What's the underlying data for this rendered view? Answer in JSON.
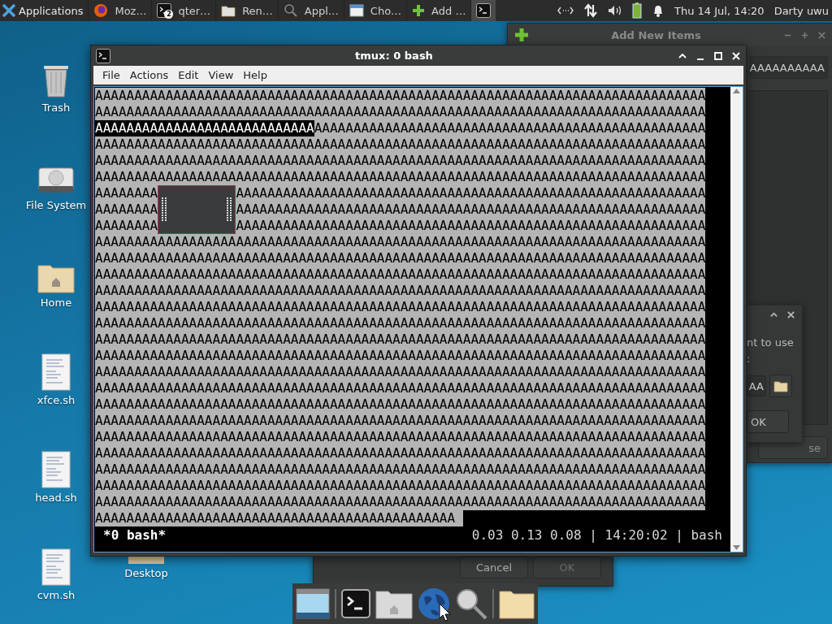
{
  "top_panel": {
    "app_menu": {
      "label": "Applications"
    },
    "tasks": [
      {
        "kind": "browser",
        "label": "Moz…",
        "selected": false
      },
      {
        "kind": "terminal",
        "label": "qter…",
        "badge": "2",
        "selected": false
      },
      {
        "kind": "folder",
        "label": "Ren…",
        "selected": false
      },
      {
        "kind": "search",
        "label": "Appl…",
        "selected": false
      },
      {
        "kind": "window",
        "label": "Cho…",
        "selected": false
      },
      {
        "kind": "plus",
        "label": "Add …",
        "selected": false
      },
      {
        "kind": "terminal",
        "selected": true
      }
    ],
    "tray": {
      "datetime": "Thu 14 Jul, 14:20",
      "user": "Darty uwu"
    }
  },
  "desktop_icons": [
    {
      "kind": "trash",
      "label": "Trash"
    },
    {
      "kind": "drive",
      "label": "File System"
    },
    {
      "kind": "home",
      "label": "Home"
    },
    {
      "kind": "script",
      "label": "xfce.sh"
    },
    {
      "kind": "script",
      "label": "head.sh"
    },
    {
      "kind": "script",
      "label": "cvm.sh"
    }
  ],
  "desktop_folder": {
    "label": "Desktop"
  },
  "add_items_window": {
    "title": "Add New Items",
    "field_value": "AAAAAAAAAA",
    "button": "se"
  },
  "small_dialog": {
    "text_lines": [
      "nt to use",
      ":"
    ],
    "field_value": "AA",
    "ok_button": "OK"
  },
  "bottom_dialog": {
    "buttons": [
      {
        "label": "Cancel",
        "disabled": false
      },
      {
        "label": "OK",
        "disabled": true
      }
    ]
  },
  "terminal": {
    "title": "tmux: 0 bash",
    "menu": [
      "File",
      "Actions",
      "Edit",
      "View",
      "Help"
    ],
    "lines": [
      {
        "segments": [
          {
            "text": "AAAAAAAAAAAAAAAAAAAAAAAAAAAAAAAAAAAAAAAAAAAAAAAAAAAAAAAAAAAAAAAAAAAAAAAAAAAAAA",
            "selected": false
          }
        ]
      },
      {
        "segments": [
          {
            "text": "AAAAAAAAAAAAAAAAAAAAAAAAAAAAAAAAAAAAAAAAAAAAAAAAAAAAAAAAAAAAAAAAAAAAAAAAAAAAAA",
            "selected": false
          }
        ]
      },
      {
        "segments": [
          {
            "text": "AAAAAAAAAAAAAAAAAAAAAAAAAAAA",
            "selected": true
          },
          {
            "text": "AAAAAAAAAAAAAAAAAAAAAAAAAAAAAAAAAAAAAAAAAAAAAAAAAA",
            "selected": false
          }
        ]
      },
      {
        "segments": [
          {
            "text": "AAAAAAAAAAAAAAAAAAAAAAAAAAAAAAAAAAAAAAAAAAAAAAAAAAAAAAAAAAAAAAAAAAAAAAAAAAAAAA",
            "selected": false
          }
        ]
      },
      {
        "segments": [
          {
            "text": "AAAAAAAAAAAAAAAAAAAAAAAAAAAAAAAAAAAAAAAAAAAAAAAAAAAAAAAAAAAAAAAAAAAAAAAAAAAAAA",
            "selected": false
          }
        ]
      },
      {
        "segments": [
          {
            "text": "AAAAAAAAAAAAAAAAAAAAAAAAAAAAAAAAAAAAAAAAAAAAAAAAAAAAAAAAAAAAAAAAAAAAAAAAAAAAAA",
            "selected": false
          }
        ]
      },
      {
        "covered": true,
        "segments": [
          {
            "text": "AAAAAAAA",
            "selected": false
          },
          {
            "text": "AAAAAAAAAAAAAAAAAAAAAAAAAAAAAAAAAAAAAAAAAAAAAAAAAAAAAAAAAAAA",
            "selected": false
          }
        ]
      },
      {
        "covered": true,
        "segments": [
          {
            "text": "AAAAAAAA",
            "selected": false
          },
          {
            "text": "AAAAAAAAAAAAAAAAAAAAAAAAAAAAAAAAAAAAAAAAAAAAAAAAAAAAAAAAAAAA",
            "selected": false
          }
        ]
      },
      {
        "covered": true,
        "segments": [
          {
            "text": "AAAAAAAA",
            "selected": false
          },
          {
            "text": "AAAAAAAAAAAAAAAAAAAAAAAAAAAAAAAAAAAAAAAAAAAAAAAAAAAAAAAAAAAA",
            "selected": false
          }
        ]
      },
      {
        "segments": [
          {
            "text": "AAAAAAAAAAAAAAAAAAAAAAAAAAAAAAAAAAAAAAAAAAAAAAAAAAAAAAAAAAAAAAAAAAAAAAAAAAAAAA",
            "selected": false
          }
        ]
      },
      {
        "segments": [
          {
            "text": "AAAAAAAAAAAAAAAAAAAAAAAAAAAAAAAAAAAAAAAAAAAAAAAAAAAAAAAAAAAAAAAAAAAAAAAAAAAAAA",
            "selected": false
          }
        ]
      },
      {
        "segments": [
          {
            "text": "AAAAAAAAAAAAAAAAAAAAAAAAAAAAAAAAAAAAAAAAAAAAAAAAAAAAAAAAAAAAAAAAAAAAAAAAAAAAAA",
            "selected": false
          }
        ]
      },
      {
        "segments": [
          {
            "text": "AAAAAAAAAAAAAAAAAAAAAAAAAAAAAAAAAAAAAAAAAAAAAAAAAAAAAAAAAAAAAAAAAAAAAAAAAAAAAA",
            "selected": false
          }
        ]
      },
      {
        "segments": [
          {
            "text": "AAAAAAAAAAAAAAAAAAAAAAAAAAAAAAAAAAAAAAAAAAAAAAAAAAAAAAAAAAAAAAAAAAAAAAAAAAAAAA",
            "selected": false
          }
        ]
      },
      {
        "segments": [
          {
            "text": "AAAAAAAAAAAAAAAAAAAAAAAAAAAAAAAAAAAAAAAAAAAAAAAAAAAAAAAAAAAAAAAAAAAAAAAAAAAAAA",
            "selected": false
          }
        ]
      },
      {
        "segments": [
          {
            "text": "AAAAAAAAAAAAAAAAAAAAAAAAAAAAAAAAAAAAAAAAAAAAAAAAAAAAAAAAAAAAAAAAAAAAAAAAAAAAAA",
            "selected": false
          }
        ]
      },
      {
        "segments": [
          {
            "text": "AAAAAAAAAAAAAAAAAAAAAAAAAAAAAAAAAAAAAAAAAAAAAAAAAAAAAAAAAAAAAAAAAAAAAAAAAAAAAA",
            "selected": false
          }
        ]
      },
      {
        "segments": [
          {
            "text": "AAAAAAAAAAAAAAAAAAAAAAAAAAAAAAAAAAAAAAAAAAAAAAAAAAAAAAAAAAAAAAAAAAAAAAAAAAAAAA",
            "selected": false
          }
        ]
      },
      {
        "segments": [
          {
            "text": "AAAAAAAAAAAAAAAAAAAAAAAAAAAAAAAAAAAAAAAAAAAAAAAAAAAAAAAAAAAAAAAAAAAAAAAAAAAAAA",
            "selected": false
          }
        ]
      },
      {
        "segments": [
          {
            "text": "AAAAAAAAAAAAAAAAAAAAAAAAAAAAAAAAAAAAAAAAAAAAAAAAAAAAAAAAAAAAAAAAAAAAAAAAAAAAAA",
            "selected": false
          }
        ]
      },
      {
        "segments": [
          {
            "text": "AAAAAAAAAAAAAAAAAAAAAAAAAAAAAAAAAAAAAAAAAAAAAAAAAAAAAAAAAAAAAAAAAAAAAAAAAAAAAA",
            "selected": false
          }
        ]
      },
      {
        "segments": [
          {
            "text": "AAAAAAAAAAAAAAAAAAAAAAAAAAAAAAAAAAAAAAAAAAAAAAAAAAAAAAAAAAAAAAAAAAAAAAAAAAAAAA",
            "selected": false
          }
        ]
      },
      {
        "segments": [
          {
            "text": "AAAAAAAAAAAAAAAAAAAAAAAAAAAAAAAAAAAAAAAAAAAAAAAAAAAAAAAAAAAAAAAAAAAAAAAAAAAAAA",
            "selected": false
          }
        ]
      },
      {
        "segments": [
          {
            "text": "AAAAAAAAAAAAAAAAAAAAAAAAAAAAAAAAAAAAAAAAAAAAAAAAAAAAAAAAAAAAAAAAAAAAAAAAAAAAAA",
            "selected": false
          }
        ]
      },
      {
        "segments": [
          {
            "text": "AAAAAAAAAAAAAAAAAAAAAAAAAAAAAAAAAAAAAAAAAAAAAAAAAAAAAAAAAAAAAAAAAAAAAAAAAAAAAA",
            "selected": false
          }
        ]
      },
      {
        "segments": [
          {
            "text": "AAAAAAAAAAAAAAAAAAAAAAAAAAAAAAAAAAAAAAAAAAAAAAAAAAAAAAAAAAAAAAAAAAAAAAAAAAAAAA",
            "selected": false
          }
        ]
      },
      {
        "cursor": true,
        "segments": [
          {
            "text": "AAAAAAAAAAAAAAAAAAAAAAAAAAAAAAAAAAAAAAAAAAAAAA",
            "selected": false
          }
        ]
      }
    ],
    "status_left": "*0 bash*",
    "status_right": "0.03 0.13 0.08 | 14:20:02 | bash"
  },
  "dock": [
    {
      "kind": "window"
    },
    {
      "kind": "separator"
    },
    {
      "kind": "terminal"
    },
    {
      "kind": "home-folder"
    },
    {
      "kind": "globe"
    },
    {
      "kind": "magnifier"
    },
    {
      "kind": "separator"
    },
    {
      "kind": "folder"
    }
  ]
}
